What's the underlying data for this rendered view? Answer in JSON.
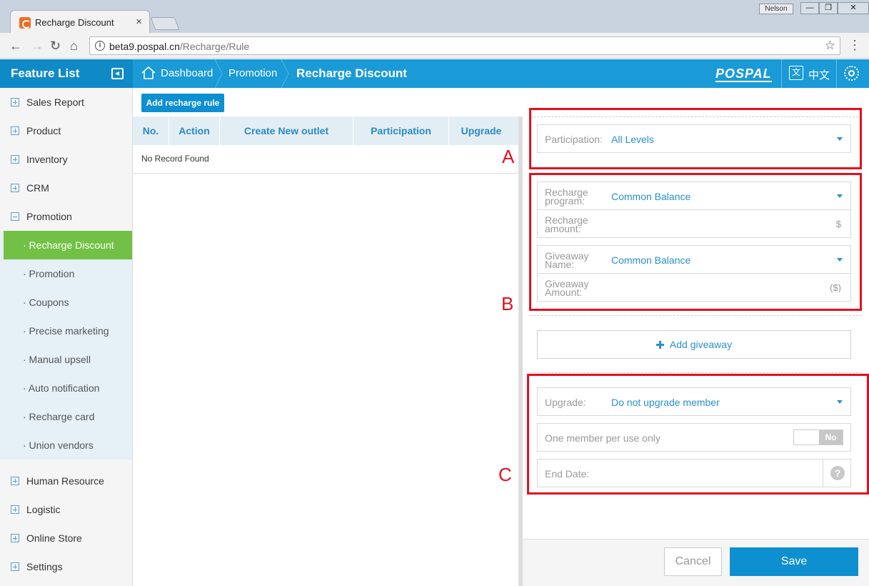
{
  "browser": {
    "tab_title": "Recharge Discount",
    "tab_close": "×",
    "user": "Nelson",
    "url_host": "beta9.pospal.cn",
    "url_path": "/Recharge/Rule"
  },
  "header": {
    "feature_list": "Feature List",
    "breadcrumb": [
      "Dashboard",
      "Promotion",
      "Recharge Discount"
    ],
    "logo": "POSPAL",
    "language": "中文",
    "language_icon": "文"
  },
  "sidebar": {
    "items": [
      {
        "label": "Sales Report",
        "expanded": false
      },
      {
        "label": "Product",
        "expanded": false
      },
      {
        "label": "Inventory",
        "expanded": false
      },
      {
        "label": "CRM",
        "expanded": false
      },
      {
        "label": "Promotion",
        "expanded": true
      },
      {
        "label": "Human Resource",
        "expanded": false
      },
      {
        "label": "Logistic",
        "expanded": false
      },
      {
        "label": "Online Store",
        "expanded": false
      },
      {
        "label": "Settings",
        "expanded": false
      }
    ],
    "promotion_sub": [
      "· Recharge Discount",
      "· Promotion",
      "· Coupons",
      "· Precise marketing",
      "· Manual upsell",
      "· Auto notification",
      "· Recharge card",
      "· Union vendors"
    ],
    "active_sub": "· Recharge Discount"
  },
  "main": {
    "add_button": "Add recharge rule",
    "columns": [
      "No.",
      "Action",
      "Create New outlet",
      "Participation",
      "Upgrade"
    ],
    "empty_text": "No Record Found"
  },
  "form": {
    "participation_label": "Participation:",
    "participation_value": "All Levels",
    "recharge_program_label": "Recharge program:",
    "recharge_program_value": "Common Balance",
    "recharge_amount_label": "Recharge amount:",
    "recharge_amount_unit": "$",
    "giveaway_name_label": "Giveaway Name:",
    "giveaway_name_value": "Common Balance",
    "giveaway_amount_label": "Giveaway Amount:",
    "giveaway_amount_unit": "($)",
    "add_giveaway": "Add giveaway",
    "upgrade_label": "Upgrade:",
    "upgrade_value": "Do not upgrade member",
    "one_member_label": "One member per use only",
    "one_member_toggle": "No",
    "end_date_label": "End Date:",
    "help": "?"
  },
  "annotations": [
    "A",
    "B",
    "C"
  ],
  "footer": {
    "cancel": "Cancel",
    "save": "Save"
  },
  "colors": {
    "accent": "#1a9ad6",
    "active_green": "#72c045",
    "annotation_red": "#e3101e"
  }
}
